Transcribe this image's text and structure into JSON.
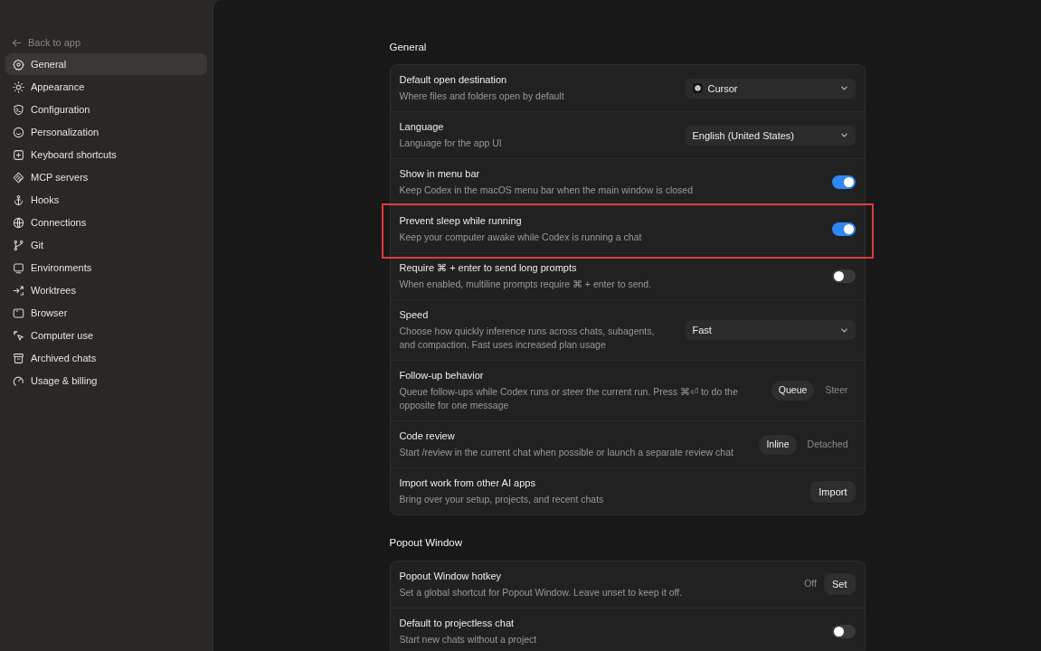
{
  "sidebar": {
    "back_link": "Back to app",
    "items": [
      {
        "label": "General",
        "selected": true
      },
      {
        "label": "Appearance",
        "selected": false
      },
      {
        "label": "Configuration",
        "selected": false
      },
      {
        "label": "Personalization",
        "selected": false
      },
      {
        "label": "Keyboard shortcuts",
        "selected": false
      },
      {
        "label": "MCP servers",
        "selected": false
      },
      {
        "label": "Hooks",
        "selected": false
      },
      {
        "label": "Connections",
        "selected": false
      },
      {
        "label": "Git",
        "selected": false
      },
      {
        "label": "Environments",
        "selected": false
      },
      {
        "label": "Worktrees",
        "selected": false
      },
      {
        "label": "Browser",
        "selected": false
      },
      {
        "label": "Computer use",
        "selected": false
      },
      {
        "label": "Archived chats",
        "selected": false
      },
      {
        "label": "Usage & billing",
        "selected": false
      }
    ]
  },
  "sections": [
    {
      "title": "General",
      "rows": [
        {
          "title": "Default open destination",
          "description": "Where files and folders open by default",
          "kind": "select",
          "value": "Cursor",
          "has_icon": true
        },
        {
          "title": "Language",
          "description": "Language for the app UI",
          "kind": "select",
          "value": "English (United States)"
        },
        {
          "title": "Show in menu bar",
          "description": "Keep Codex in the macOS menu bar when the main window is closed",
          "kind": "toggle",
          "on": true
        },
        {
          "title": "Prevent sleep while running",
          "description": "Keep your computer awake while Codex is running a chat",
          "kind": "toggle",
          "on": true,
          "highlighted": true
        },
        {
          "title": "Require ⌘ + enter to send long prompts",
          "description": "When enabled, multiline prompts require ⌘ + enter to send.",
          "kind": "toggle",
          "on": false
        },
        {
          "title": "Speed",
          "description": "Choose how quickly inference runs across chats, subagents, and compaction. Fast uses increased plan usage",
          "kind": "select",
          "value": "Fast"
        },
        {
          "title": "Follow-up behavior",
          "description": "Queue follow-ups while Codex runs or steer the current run. Press ⌘⏎ to do the opposite for one message",
          "kind": "segmented",
          "options": [
            {
              "label": "Queue",
              "selected": true
            },
            {
              "label": "Steer",
              "selected": false
            }
          ]
        },
        {
          "title": "Code review",
          "description": "Start /review in the current chat when possible or launch a separate review chat",
          "kind": "segmented",
          "options": [
            {
              "label": "Inline",
              "selected": true
            },
            {
              "label": "Detached",
              "selected": false
            }
          ]
        },
        {
          "title": "Import work from other AI apps",
          "description": "Bring over your setup, projects, and recent chats",
          "kind": "button",
          "button": "Import"
        }
      ]
    },
    {
      "title": "Popout Window",
      "rows": [
        {
          "title": "Popout Window hotkey",
          "description": "Set a global shortcut for Popout Window. Leave unset to keep it off.",
          "kind": "hotkey",
          "value": "Off",
          "button": "Set"
        },
        {
          "title": "Default to projectless chat",
          "description": "Start new chats without a project",
          "kind": "toggle",
          "on": false
        }
      ]
    }
  ]
}
